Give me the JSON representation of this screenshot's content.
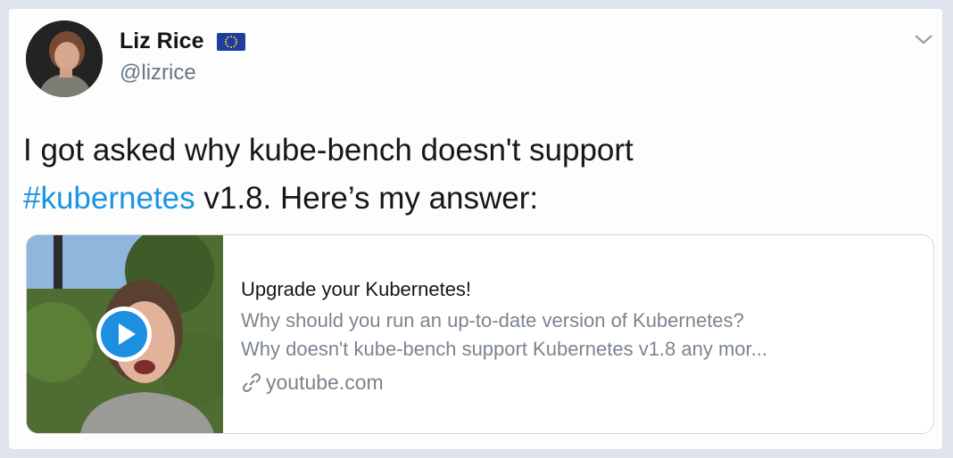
{
  "user": {
    "name": "Liz Rice",
    "handle": "@lizrice",
    "avatar_icon": "profile-photo",
    "flag_icon": "eu-flag-icon"
  },
  "tweet": {
    "text_line1": "I got asked why kube-bench doesn't support",
    "hashtag": "#kubernetes",
    "text_line2_rest": " v1.8. Here’s my answer:"
  },
  "card": {
    "title": "Upgrade your Kubernetes!",
    "desc_line1": "Why should you run an up-to-date version of Kubernetes?",
    "desc_line2": "Why doesn't kube-bench support Kubernetes v1.8 any mor...",
    "domain": "youtube.com",
    "play_icon": "play-icon"
  },
  "colors": {
    "hashtag": "#1b95e0",
    "play": "#1d8fe1"
  }
}
